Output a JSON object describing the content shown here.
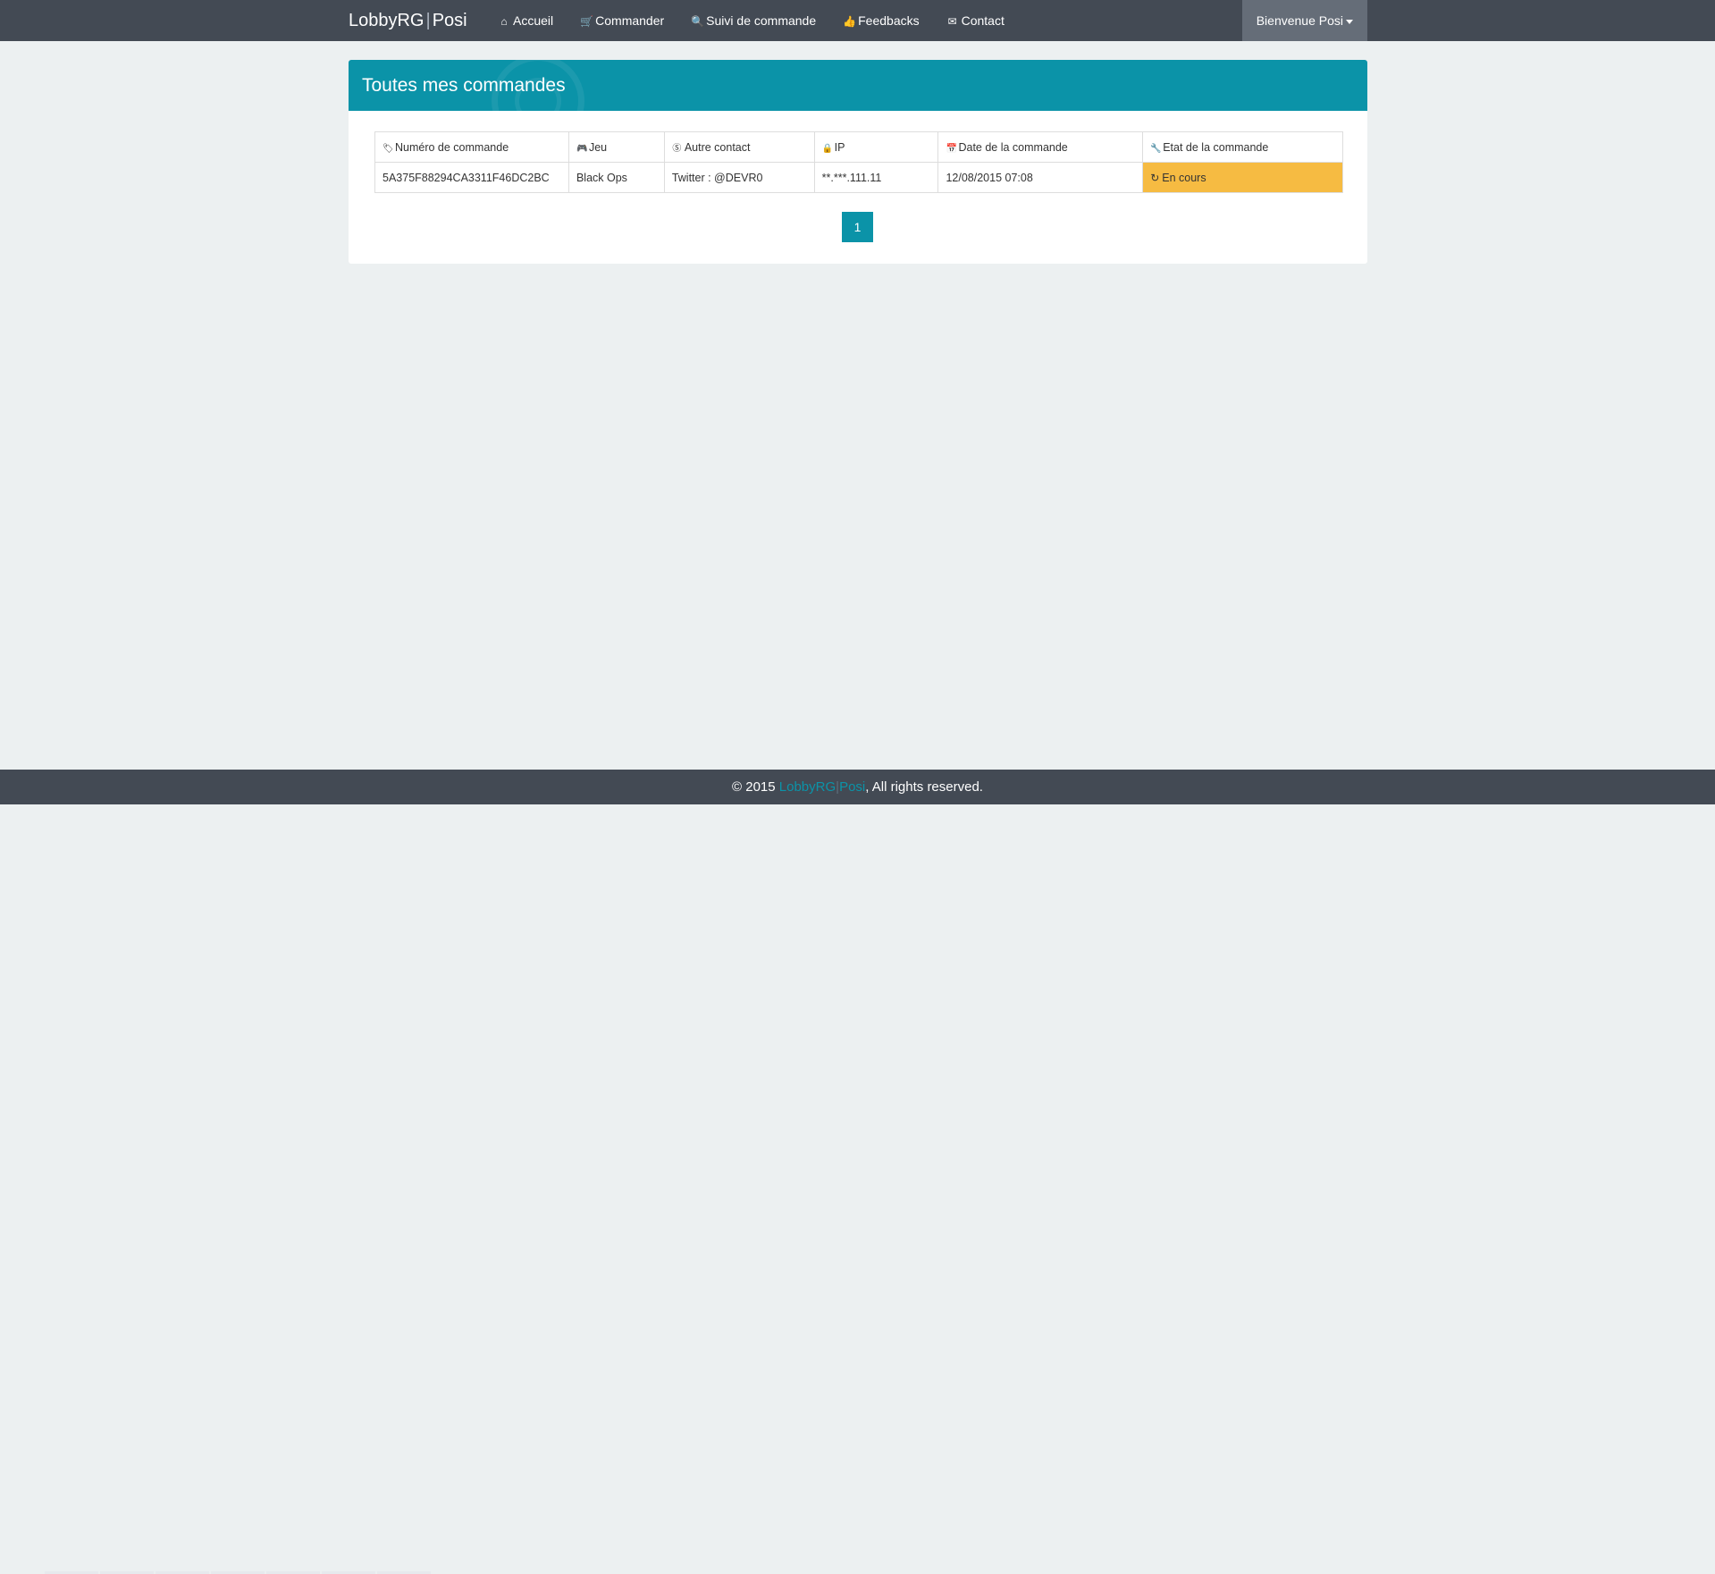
{
  "navbar": {
    "brand": {
      "part1": "LobbyRG",
      "separator": "|",
      "part2": "Posi"
    },
    "links": [
      {
        "label": "Accueil",
        "icon": "home-icon",
        "glyph": "⌂"
      },
      {
        "label": "Commander",
        "icon": "cart-icon",
        "glyph": "🛒"
      },
      {
        "label": "Suivi de commande",
        "icon": "search-icon",
        "glyph": "🔍"
      },
      {
        "label": "Feedbacks",
        "icon": "thumbs-up-icon",
        "glyph": "👍"
      },
      {
        "label": "Contact",
        "icon": "envelope-icon",
        "glyph": "✉"
      }
    ],
    "user_menu": "Bienvenue Posi"
  },
  "panel": {
    "title": "Toutes mes commandes"
  },
  "table": {
    "headers": [
      {
        "label": "Numéro de commande",
        "icon": "tag-icon",
        "glyph": "🏷"
      },
      {
        "label": "Jeu",
        "icon": "gamepad-icon",
        "glyph": "🎮"
      },
      {
        "label": "Autre contact",
        "icon": "skype-icon",
        "glyph": "Ⓢ"
      },
      {
        "label": "IP",
        "icon": "user-secret-icon",
        "glyph": "🔒"
      },
      {
        "label": "Date de la commande",
        "icon": "calendar-icon",
        "glyph": "📅"
      },
      {
        "label": "Etat de la commande",
        "icon": "wrench-icon",
        "glyph": "🔧"
      }
    ],
    "rows": [
      {
        "order_number": "5A375F88294CA3311F46DC2BC",
        "game": "Black Ops",
        "contact": "Twitter : @DEVR0",
        "ip": "**.***.111.11",
        "date": "12/08/2015 07:08",
        "status": "En cours",
        "status_icon": "refresh-icon",
        "status_glyph": "↻"
      }
    ]
  },
  "pagination": {
    "current": "1"
  },
  "footer": {
    "prefix": "© 2015 ",
    "brand_part1": "LobbyRG",
    "brand_separator": "|",
    "brand_part2": "Posi",
    "suffix": ", All rights reserved."
  },
  "colors": {
    "navbar": "#434a54",
    "accent": "#0b93a8",
    "status_pending": "#f6bb42",
    "background": "#ecf0f1",
    "user_menu": "#656d78"
  }
}
